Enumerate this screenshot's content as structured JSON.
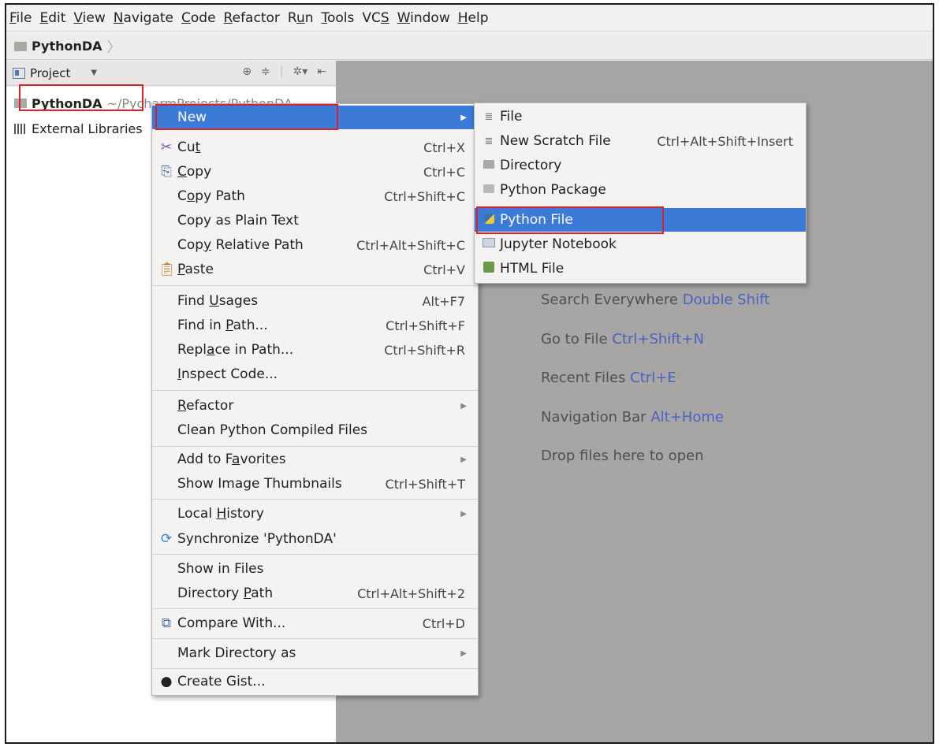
{
  "menubar": {
    "items": [
      {
        "u": "F",
        "rest": "ile"
      },
      {
        "u": "E",
        "rest": "dit"
      },
      {
        "u": "V",
        "rest": "iew"
      },
      {
        "u": "N",
        "rest": "avigate"
      },
      {
        "u": "C",
        "rest": "ode"
      },
      {
        "u": "R",
        "rest": "efactor"
      },
      {
        "pre": "R",
        "u": "u",
        "rest": "n"
      },
      {
        "u": "T",
        "rest": "ools"
      },
      {
        "pre": "VC",
        "u": "S",
        "rest": ""
      },
      {
        "u": "W",
        "rest": "indow"
      },
      {
        "u": "H",
        "rest": "elp"
      }
    ]
  },
  "navbar": {
    "crumb": "PythonDA"
  },
  "project_pane": {
    "title": "Project",
    "root_name": "PythonDA",
    "root_path": "~/PycharmProjects/PythonDA",
    "external": "External Libraries"
  },
  "context_menu": {
    "new": "New",
    "cut": {
      "pre": "Cu",
      "u": "t",
      "post": "",
      "sc": "Ctrl+X"
    },
    "copy": {
      "pre": "",
      "u": "C",
      "post": "opy",
      "sc": "Ctrl+C"
    },
    "copy_path": {
      "pre": "C",
      "u": "o",
      "post": "py Path",
      "sc": "Ctrl+Shift+C"
    },
    "copy_plain": "Copy as Plain Text",
    "copy_relative": {
      "pre": "Cop",
      "u": "y",
      "post": " Relative Path",
      "sc": "Ctrl+Alt+Shift+C"
    },
    "paste": {
      "pre": "",
      "u": "P",
      "post": "aste",
      "sc": "Ctrl+V"
    },
    "find_usages": {
      "pre": "Find ",
      "u": "U",
      "post": "sages",
      "sc": "Alt+F7"
    },
    "find_in_path": {
      "pre": "Find in ",
      "u": "P",
      "post": "ath...",
      "sc": "Ctrl+Shift+F"
    },
    "replace_in_path": {
      "pre": "Repl",
      "u": "a",
      "post": "ce in Path...",
      "sc": "Ctrl+Shift+R"
    },
    "inspect_code": {
      "pre": "",
      "u": "I",
      "post": "nspect Code..."
    },
    "refactor": {
      "pre": "",
      "u": "R",
      "post": "efactor"
    },
    "clean_python": "Clean Python Compiled Files",
    "add_favorites": {
      "pre": "Add to F",
      "u": "a",
      "post": "vorites"
    },
    "show_thumbs": {
      "label": "Show Image Thumbnails",
      "sc": "Ctrl+Shift+T"
    },
    "local_history": {
      "pre": "Local ",
      "u": "H",
      "post": "istory"
    },
    "synchronize": "Synchronize 'PythonDA'",
    "show_in_files": "Show in Files",
    "directory_path": {
      "pre": "Directory ",
      "u": "P",
      "post": "ath",
      "sc": "Ctrl+Alt+Shift+2"
    },
    "compare_with": {
      "label": "Compare With...",
      "sc": "Ctrl+D"
    },
    "mark_directory": "Mark Directory as",
    "create_gist": "Create Gist..."
  },
  "new_submenu": {
    "file": "File",
    "scratch": {
      "label": "New Scratch File",
      "sc": "Ctrl+Alt+Shift+Insert"
    },
    "directory": "Directory",
    "package": "Python Package",
    "python_file": "Python File",
    "jupyter": "Jupyter Notebook",
    "html": "HTML File"
  },
  "editor_hints": [
    {
      "text": "Search Everywhere",
      "sc": "Double Shift"
    },
    {
      "text": "Go to File",
      "sc": "Ctrl+Shift+N"
    },
    {
      "text": "Recent Files",
      "sc": "Ctrl+E"
    },
    {
      "text": "Navigation Bar",
      "sc": "Alt+Home"
    },
    {
      "text": "Drop files here to open",
      "sc": ""
    }
  ],
  "colors": {
    "selection": "#3b7ad7",
    "highlight_box": "#d8232a",
    "shortcut_blue": "#4a63c2"
  }
}
